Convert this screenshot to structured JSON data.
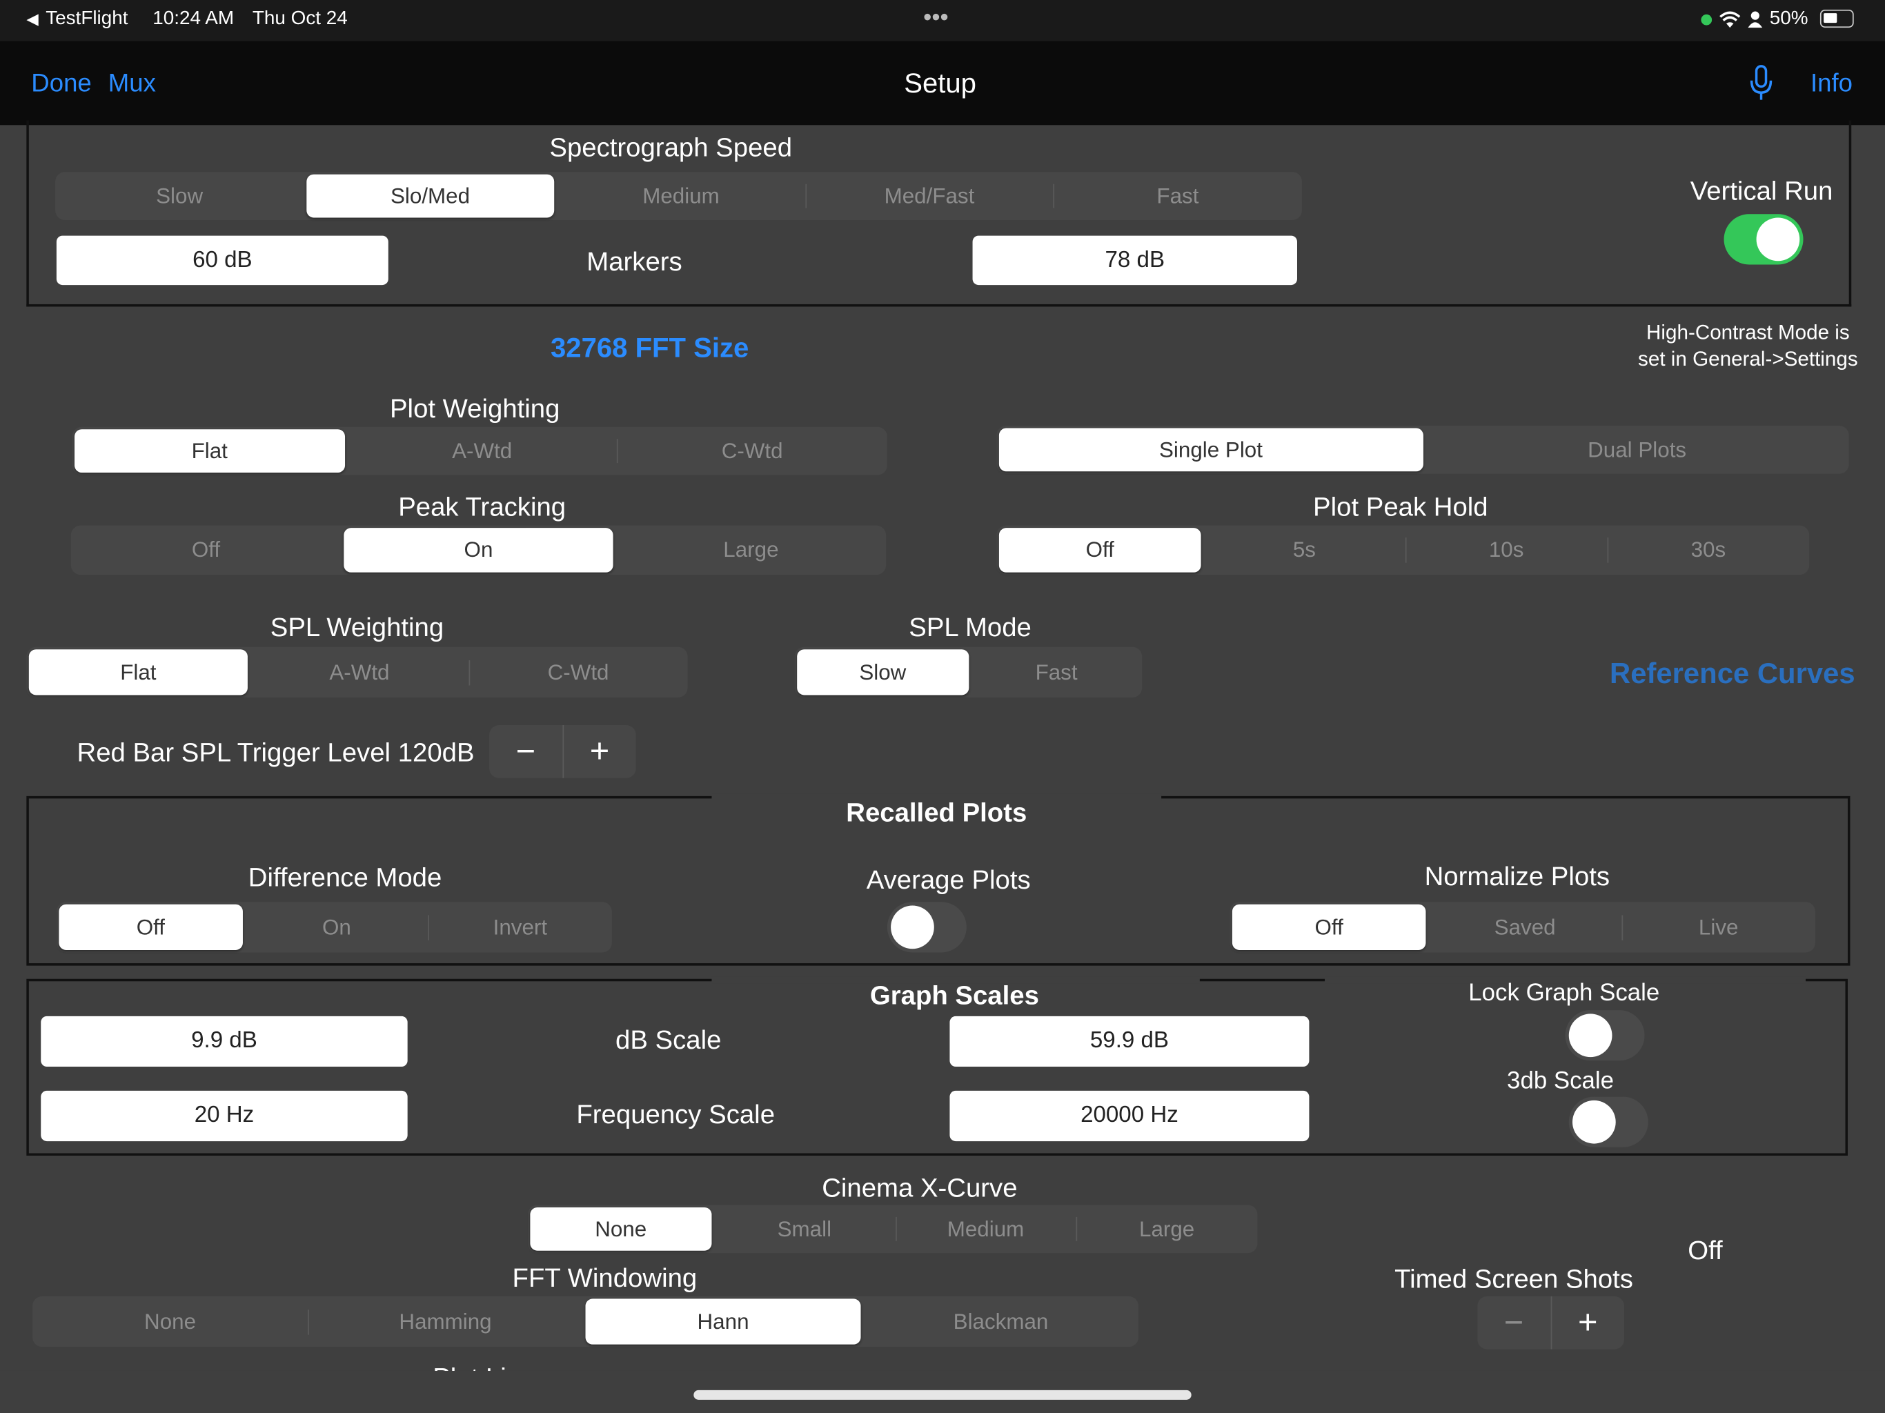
{
  "status_bar": {
    "back_app": "TestFlight",
    "time": "10:24 AM",
    "date": "Thu Oct 24",
    "dots": "•••",
    "battery": "50%"
  },
  "nav": {
    "done": "Done",
    "mux": "Mux",
    "title": "Setup",
    "info": "Info"
  },
  "spectrograph_speed": {
    "label": "Spectrograph Speed",
    "options": [
      "Slow",
      "Slo/Med",
      "Medium",
      "Med/Fast",
      "Fast"
    ],
    "selected": 1
  },
  "markers": {
    "label": "Markers",
    "low": "60 dB",
    "high": "78 dB"
  },
  "vertical_run": {
    "label": "Vertical Run",
    "on": true
  },
  "fft_size": "32768 FFT Size",
  "high_contrast_note": [
    "High-Contrast Mode is",
    "set in General->Settings"
  ],
  "plot_weighting": {
    "label": "Plot Weighting",
    "options": [
      "Flat",
      "A-Wtd",
      "C-Wtd"
    ],
    "selected": 0
  },
  "plot_count": {
    "options": [
      "Single Plot",
      "Dual Plots"
    ],
    "selected": 0
  },
  "peak_tracking": {
    "label": "Peak Tracking",
    "options": [
      "Off",
      "On",
      "Large"
    ],
    "selected": 1
  },
  "plot_peak_hold": {
    "label": "Plot Peak Hold",
    "options": [
      "Off",
      "5s",
      "10s",
      "30s"
    ],
    "selected": 0
  },
  "spl_weighting": {
    "label": "SPL Weighting",
    "options": [
      "Flat",
      "A-Wtd",
      "C-Wtd"
    ],
    "selected": 0
  },
  "spl_mode": {
    "label": "SPL Mode",
    "options": [
      "Slow",
      "Fast"
    ],
    "selected": 0
  },
  "reference_curves": "Reference Curves",
  "red_bar": {
    "label": "Red Bar SPL Trigger Level 120dB",
    "minus": "−",
    "plus": "+"
  },
  "recalled_plots": {
    "title": "Recalled Plots",
    "difference_mode": {
      "label": "Difference Mode",
      "options": [
        "Off",
        "On",
        "Invert"
      ],
      "selected": 0
    },
    "average_plots": {
      "label": "Average Plots",
      "on": false
    },
    "normalize_plots": {
      "label": "Normalize Plots",
      "options": [
        "Off",
        "Saved",
        "Live"
      ],
      "selected": 0
    }
  },
  "graph_scales": {
    "title": "Graph Scales",
    "db_scale": {
      "label": "dB Scale",
      "low": "9.9 dB",
      "high": "59.9 dB"
    },
    "freq_scale": {
      "label": "Frequency Scale",
      "low": "20 Hz",
      "high": "20000 Hz"
    },
    "lock_graph_scale": {
      "label": "Lock Graph Scale",
      "on": false
    },
    "three_db_scale": {
      "label": "3db Scale",
      "on": false
    }
  },
  "cinema_x_curve": {
    "label": "Cinema X-Curve",
    "options": [
      "None",
      "Small",
      "Medium",
      "Large"
    ],
    "selected": 0
  },
  "fft_windowing": {
    "label": "FFT Windowing",
    "options": [
      "None",
      "Hamming",
      "Hann",
      "Blackman"
    ],
    "selected": 2
  },
  "timed_screen_shots": {
    "label": "Timed Screen Shots",
    "value": "Off",
    "minus": "−",
    "plus": "+"
  },
  "partial_label": "Plot Line"
}
